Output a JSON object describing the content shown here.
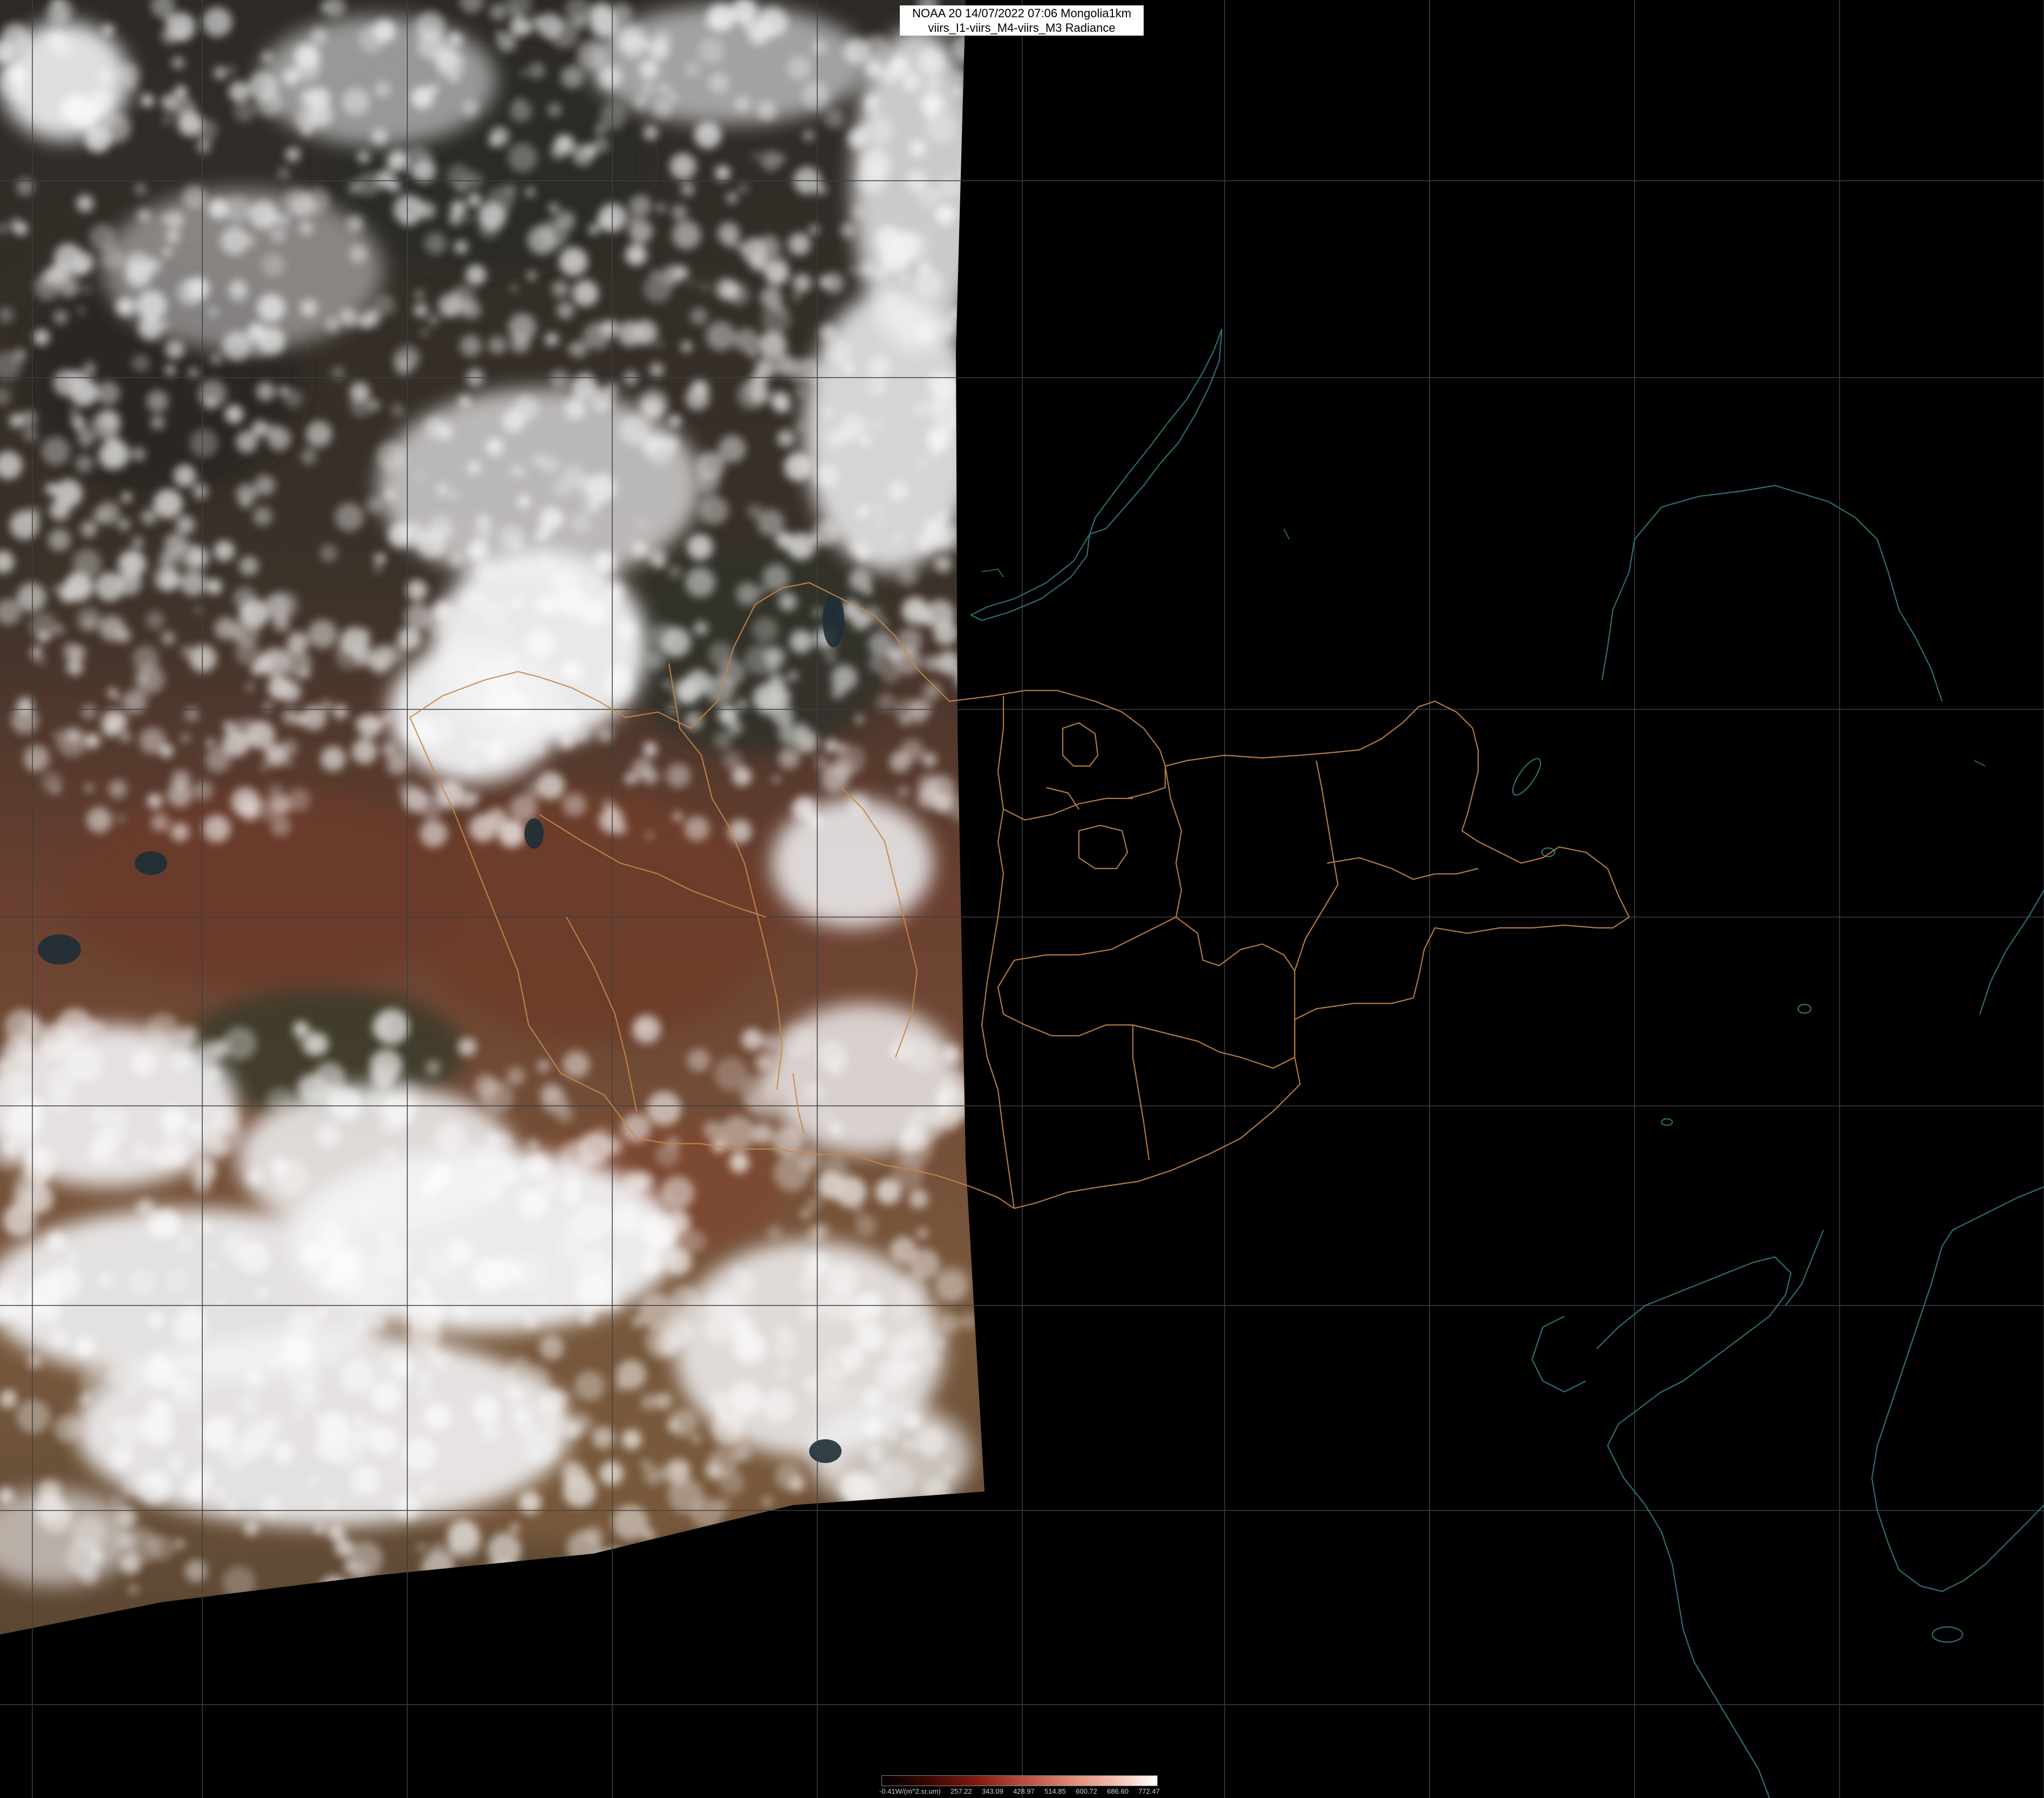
{
  "title": {
    "line1": "NOAA 20 14/07/2022 07:06 Mongolia1km",
    "line2": "viirs_I1-viirs_M4-viirs_M3 Radiance"
  },
  "legend": {
    "labels": [
      "-0.41W/(m^2.sr.um)",
      "257.22",
      "343.09",
      "428.97",
      "514.85",
      "600.72",
      "686.60",
      "772.47"
    ],
    "colors": [
      "#000000",
      "#3a0800",
      "#7a1a10",
      "#b34a3a",
      "#d9826f",
      "#efb9a8",
      "#ffffff"
    ]
  },
  "colors": {
    "background": "#000000",
    "grid": "#3a3f45",
    "admin_border": "#c8874a",
    "coastline": "#2f6f78",
    "cloud": "#f4f4f6",
    "terrain": "#6b4030"
  }
}
